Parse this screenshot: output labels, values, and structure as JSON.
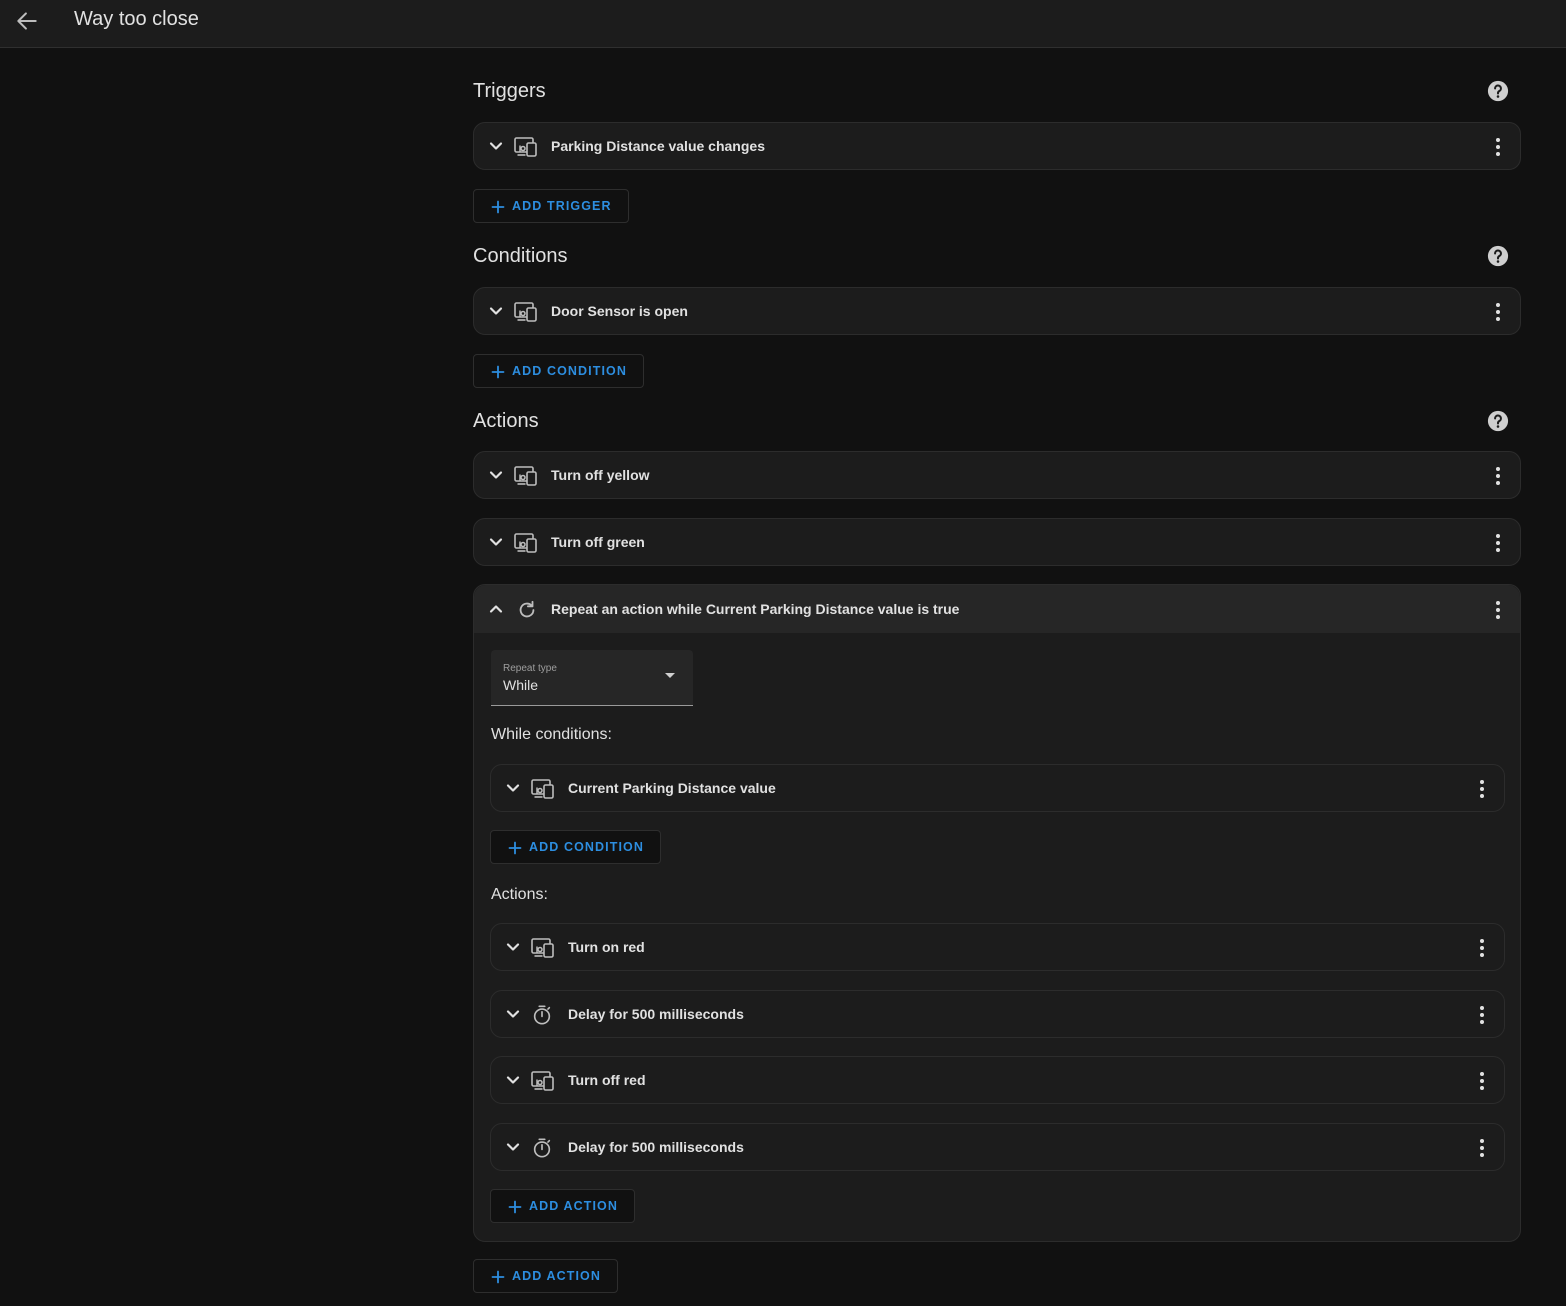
{
  "header": {
    "title": "Way too close"
  },
  "triggers": {
    "heading": "Triggers",
    "items": [
      {
        "label": "Parking Distance value changes",
        "icon": "device-icon"
      }
    ],
    "add_label": "ADD TRIGGER"
  },
  "conditions": {
    "heading": "Conditions",
    "items": [
      {
        "label": "Door Sensor is open",
        "icon": "device-icon"
      }
    ],
    "add_label": "ADD CONDITION"
  },
  "actions": {
    "heading": "Actions",
    "items": [
      {
        "label": "Turn off yellow",
        "icon": "device-icon"
      },
      {
        "label": "Turn off green",
        "icon": "device-icon"
      }
    ],
    "repeat": {
      "label": "Repeat an action while Current Parking Distance value is true",
      "icon": "repeat-icon",
      "repeat_type_label": "Repeat type",
      "repeat_type_value": "While",
      "while_label": "While conditions:",
      "while_items": [
        {
          "label": "Current Parking Distance value",
          "icon": "device-icon"
        }
      ],
      "while_add_label": "ADD CONDITION",
      "actions_label": "Actions:",
      "action_items": [
        {
          "label": "Turn on red",
          "icon": "device-icon"
        },
        {
          "label": "Delay for 500 milliseconds",
          "icon": "timer-icon"
        },
        {
          "label": "Turn off red",
          "icon": "device-icon"
        },
        {
          "label": "Delay for 500 milliseconds",
          "icon": "timer-icon"
        }
      ],
      "inner_add_label": "ADD ACTION"
    },
    "add_label": "ADD ACTION"
  },
  "colors": {
    "background": "#111111",
    "card": "#1c1c1c",
    "accent": "#2d8ee0",
    "text": "#e1e1e1"
  }
}
